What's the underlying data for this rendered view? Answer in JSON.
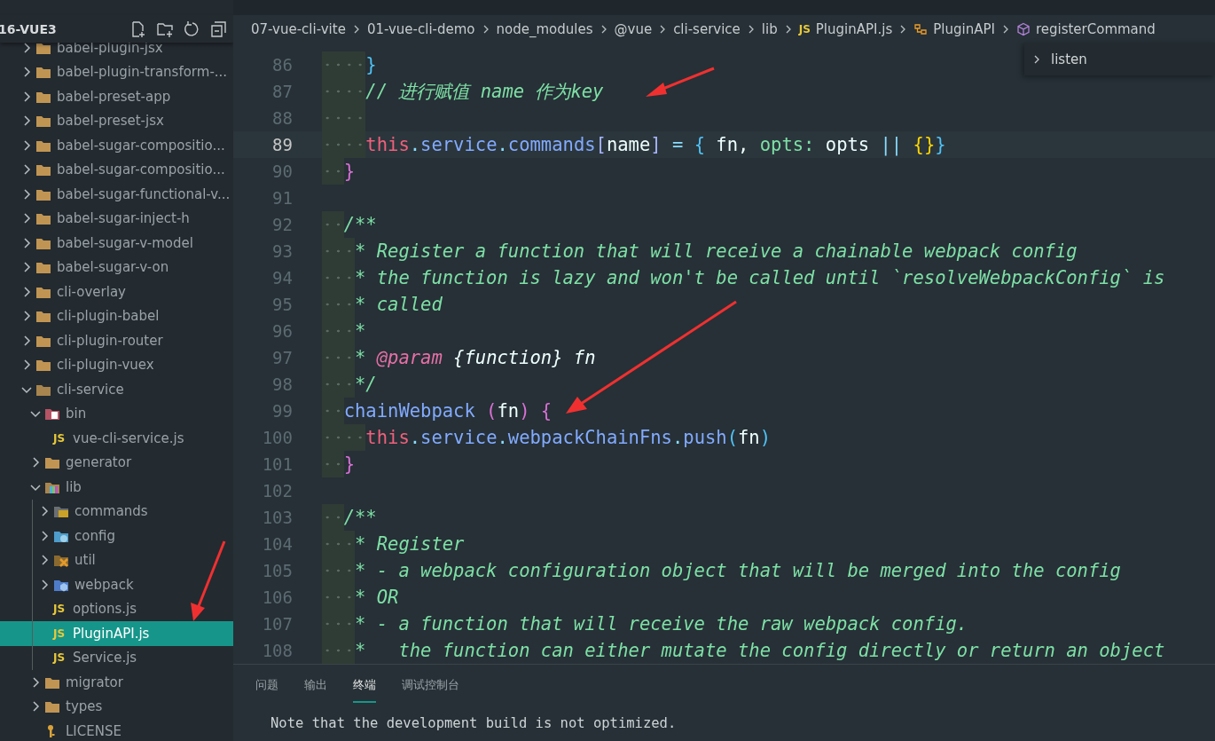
{
  "sidebar": {
    "project": "16-VUE3",
    "items": [
      {
        "label": "babel-plugin-jsx",
        "kind": "folder",
        "expanded": false,
        "selected": false
      },
      {
        "label": "babel-plugin-transform-...",
        "kind": "folder",
        "expanded": false,
        "selected": false
      },
      {
        "label": "babel-preset-app",
        "kind": "folder",
        "expanded": false,
        "selected": false
      },
      {
        "label": "babel-preset-jsx",
        "kind": "folder",
        "expanded": false,
        "selected": false
      },
      {
        "label": "babel-sugar-compositio...",
        "kind": "folder",
        "expanded": false,
        "selected": false
      },
      {
        "label": "babel-sugar-compositio...",
        "kind": "folder",
        "expanded": false,
        "selected": false
      },
      {
        "label": "babel-sugar-functional-v...",
        "kind": "folder",
        "expanded": false,
        "selected": false
      },
      {
        "label": "babel-sugar-inject-h",
        "kind": "folder",
        "expanded": false,
        "selected": false
      },
      {
        "label": "babel-sugar-v-model",
        "kind": "folder",
        "expanded": false,
        "selected": false
      },
      {
        "label": "babel-sugar-v-on",
        "kind": "folder",
        "expanded": false,
        "selected": false
      },
      {
        "label": "cli-overlay",
        "kind": "folder",
        "expanded": false,
        "selected": false
      },
      {
        "label": "cli-plugin-babel",
        "kind": "folder",
        "expanded": false,
        "selected": false
      },
      {
        "label": "cli-plugin-router",
        "kind": "folder",
        "expanded": false,
        "selected": false
      },
      {
        "label": "cli-plugin-vuex",
        "kind": "folder",
        "expanded": false,
        "selected": false
      },
      {
        "label": "cli-service",
        "kind": "folder",
        "expanded": true,
        "selected": false,
        "children": [
          {
            "label": "bin",
            "kind": "bin",
            "expanded": true,
            "selected": false,
            "children": [
              {
                "label": "vue-cli-service.js",
                "kind": "js",
                "icon_text": "JS",
                "selected": false
              }
            ]
          },
          {
            "label": "generator",
            "kind": "folder",
            "expanded": false,
            "selected": false
          },
          {
            "label": "lib",
            "kind": "lib",
            "expanded": true,
            "selected": false,
            "children": [
              {
                "label": "commands",
                "kind": "terminal",
                "expanded": false,
                "selected": false
              },
              {
                "label": "config",
                "kind": "config",
                "expanded": false,
                "selected": false
              },
              {
                "label": "util",
                "kind": "tools",
                "expanded": false,
                "selected": false
              },
              {
                "label": "webpack",
                "kind": "webpack",
                "expanded": false,
                "selected": false
              },
              {
                "label": "options.js",
                "kind": "js",
                "icon_text": "JS",
                "selected": false
              },
              {
                "label": "PluginAPI.js",
                "kind": "js",
                "icon_text": "JS",
                "selected": true
              },
              {
                "label": "Service.js",
                "kind": "js",
                "icon_text": "JS",
                "selected": false
              }
            ]
          },
          {
            "label": "migrator",
            "kind": "folder",
            "expanded": false,
            "selected": false
          },
          {
            "label": "types",
            "kind": "folder",
            "expanded": false,
            "selected": false
          },
          {
            "label": "LICENSE",
            "kind": "license",
            "selected": false
          }
        ]
      }
    ]
  },
  "breadcrumb": [
    {
      "label": "07-vue-cli-vite",
      "kind": "plain"
    },
    {
      "label": "01-vue-cli-demo",
      "kind": "plain"
    },
    {
      "label": "node_modules",
      "kind": "plain"
    },
    {
      "label": "@vue",
      "kind": "plain"
    },
    {
      "label": "cli-service",
      "kind": "plain"
    },
    {
      "label": "lib",
      "kind": "plain"
    },
    {
      "label": "PluginAPI.js",
      "kind": "js",
      "icon_text": "JS"
    },
    {
      "label": "PluginAPI",
      "kind": "class"
    },
    {
      "label": "registerCommand",
      "kind": "method"
    }
  ],
  "sticky_widget": {
    "label": "listen"
  },
  "editor": {
    "lines": [
      {
        "number": "86",
        "kind": "body",
        "current": false,
        "tokens": [
          {
            "kind": "brace",
            "text": "}"
          }
        ]
      },
      {
        "number": "87",
        "kind": "body",
        "current": false,
        "tokens": [
          {
            "kind": "comment",
            "text": "// 进行赋值 name 作为key"
          }
        ]
      },
      {
        "number": "88",
        "kind": "body",
        "current": false
      },
      {
        "number": "89",
        "kind": "body",
        "current": true,
        "tokens": [
          {
            "kind": "keyword",
            "text": "this"
          },
          {
            "kind": "punct",
            "text": "."
          },
          {
            "kind": "property",
            "text": "service"
          },
          {
            "kind": "punct",
            "text": "."
          },
          {
            "kind": "property",
            "text": "commands"
          },
          {
            "kind": "bracket",
            "text": "["
          },
          {
            "kind": "plain",
            "text": "name"
          },
          {
            "kind": "bracket",
            "text": "]"
          },
          {
            "kind": "operator",
            "text": " = "
          },
          {
            "kind": "brace",
            "text": "{"
          },
          {
            "kind": "plain",
            "text": " fn, "
          },
          {
            "kind": "key",
            "text": "opts:"
          },
          {
            "kind": "plain",
            "text": " opts "
          },
          {
            "kind": "operator",
            "text": "||"
          },
          {
            "kind": "gold",
            "text": " {}"
          },
          {
            "kind": "brace",
            "text": "}"
          }
        ]
      },
      {
        "number": "90",
        "kind": "member",
        "current": false,
        "tokens": [
          {
            "kind": "pink",
            "text": "}"
          }
        ]
      },
      {
        "number": "91",
        "kind": "blank",
        "current": false
      },
      {
        "number": "92",
        "kind": "member",
        "current": false,
        "tokens": [
          {
            "kind": "comment",
            "text": "/**"
          }
        ]
      },
      {
        "number": "93",
        "kind": "doc",
        "current": false,
        "tokens": [
          {
            "kind": "comment",
            "text": "* Register a function that will receive a chainable webpack config"
          }
        ]
      },
      {
        "number": "94",
        "kind": "doc",
        "current": false,
        "tokens": [
          {
            "kind": "comment",
            "text": "* the function is lazy and won't be called until `resolveWebpackConfig` is"
          }
        ]
      },
      {
        "number": "95",
        "kind": "doc",
        "current": false,
        "tokens": [
          {
            "kind": "comment",
            "text": "* called"
          }
        ]
      },
      {
        "number": "96",
        "kind": "doc",
        "current": false,
        "tokens": [
          {
            "kind": "comment",
            "text": "*"
          }
        ]
      },
      {
        "number": "97",
        "kind": "doc",
        "current": false,
        "tokens": [
          {
            "kind": "comment",
            "text": "* "
          },
          {
            "kind": "doctag",
            "text": "@param"
          },
          {
            "kind": "doctype",
            "text": " {function} fn"
          }
        ]
      },
      {
        "number": "98",
        "kind": "doc",
        "current": false,
        "tokens": [
          {
            "kind": "comment",
            "text": "*/"
          }
        ]
      },
      {
        "number": "99",
        "kind": "member",
        "current": false,
        "tokens": [
          {
            "kind": "function",
            "text": "chainWebpack"
          },
          {
            "kind": "pink",
            "text": " ("
          },
          {
            "kind": "plain",
            "text": "fn"
          },
          {
            "kind": "pink",
            "text": ") {"
          }
        ]
      },
      {
        "number": "100",
        "kind": "body",
        "current": false,
        "tokens": [
          {
            "kind": "keyword",
            "text": "this"
          },
          {
            "kind": "punct",
            "text": "."
          },
          {
            "kind": "property",
            "text": "service"
          },
          {
            "kind": "punct",
            "text": "."
          },
          {
            "kind": "property",
            "text": "webpackChainFns"
          },
          {
            "kind": "punct",
            "text": "."
          },
          {
            "kind": "property",
            "text": "push"
          },
          {
            "kind": "brace",
            "text": "("
          },
          {
            "kind": "plain",
            "text": "fn"
          },
          {
            "kind": "brace",
            "text": ")"
          }
        ]
      },
      {
        "number": "101",
        "kind": "member",
        "current": false,
        "tokens": [
          {
            "kind": "pink",
            "text": "}"
          }
        ]
      },
      {
        "number": "102",
        "kind": "blank",
        "current": false
      },
      {
        "number": "103",
        "kind": "member",
        "current": false,
        "tokens": [
          {
            "kind": "comment",
            "text": "/**"
          }
        ]
      },
      {
        "number": "104",
        "kind": "doc",
        "current": false,
        "tokens": [
          {
            "kind": "comment",
            "text": "* Register"
          }
        ]
      },
      {
        "number": "105",
        "kind": "doc",
        "current": false,
        "tokens": [
          {
            "kind": "comment",
            "text": "* - a webpack configuration object that will be merged into the config"
          }
        ]
      },
      {
        "number": "106",
        "kind": "doc",
        "current": false,
        "tokens": [
          {
            "kind": "comment",
            "text": "* OR"
          }
        ]
      },
      {
        "number": "107",
        "kind": "doc",
        "current": false,
        "tokens": [
          {
            "kind": "comment",
            "text": "* - a function that will receive the raw webpack config."
          }
        ]
      },
      {
        "number": "108",
        "kind": "doc",
        "current": false,
        "tokens": [
          {
            "kind": "comment",
            "text": "*   the function can either mutate the config directly or return an object"
          }
        ]
      }
    ]
  },
  "panel": {
    "tabs": [
      {
        "label": "问题",
        "selected": false
      },
      {
        "label": "输出",
        "selected": false
      },
      {
        "label": "终端",
        "selected": true
      },
      {
        "label": "调试控制台",
        "selected": false
      }
    ],
    "terminal": [
      "Note that the development build is not optimized."
    ]
  }
}
